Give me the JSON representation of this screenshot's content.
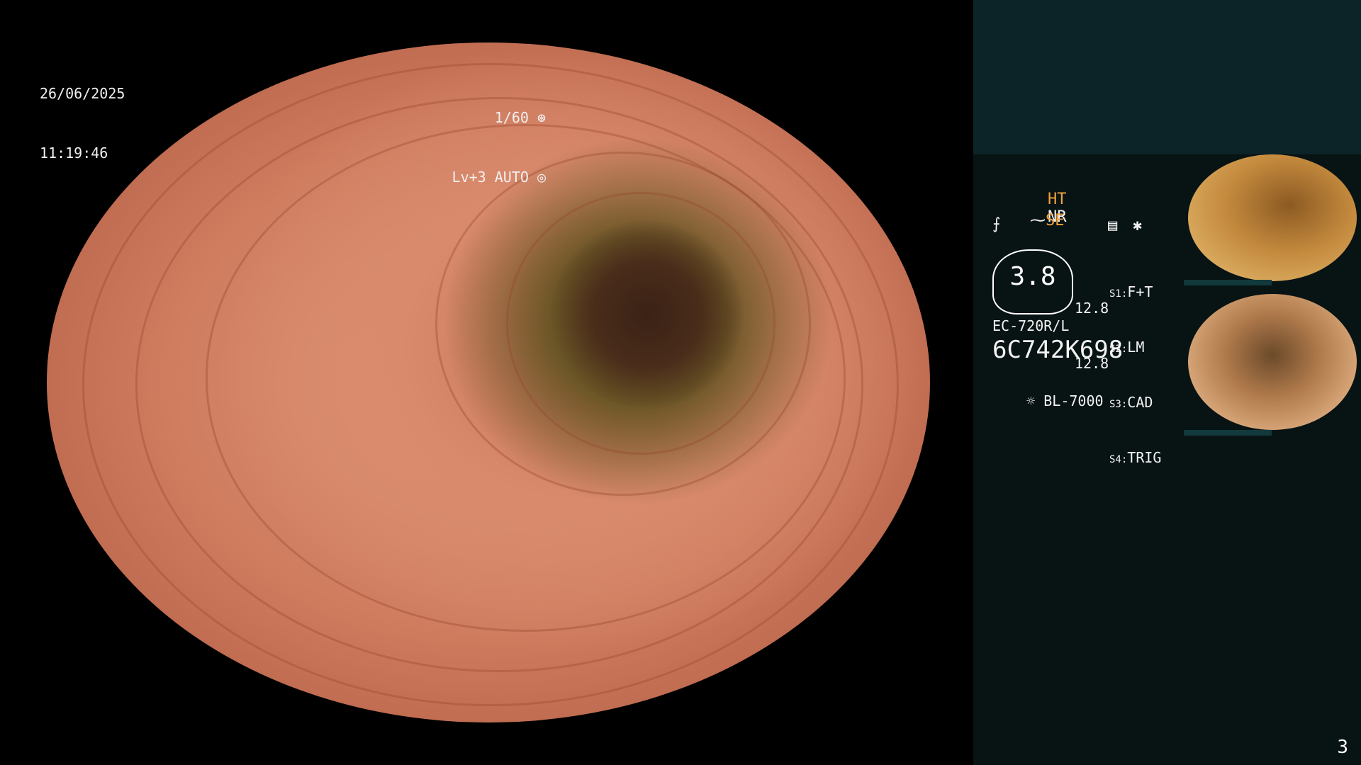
{
  "osd": {
    "date": "26/06/2025",
    "time": "11:19:46",
    "shutter": "1/60",
    "level": "Lv+3 AUTO"
  },
  "panel": {
    "ht_label": "HT",
    "nr_label": "NR",
    "se_label": "SE",
    "gauge_value": "3.8",
    "values": [
      "12.8",
      "12.8"
    ],
    "switches": [
      {
        "key": "S1:",
        "value": "F+T"
      },
      {
        "key": "S2:",
        "value": "LM"
      },
      {
        "key": "S3:",
        "value": "CAD"
      },
      {
        "key": "S4:",
        "value": "TRIG"
      }
    ],
    "scope_model": "EC-720R/L",
    "scope_serial": "6C742K698",
    "light_source": "BL-7000",
    "page_number": "3"
  },
  "icons": {
    "shutter_icon": "aperture-icon",
    "auto_icon": "iris-icon",
    "settings_icon": "menu-icon",
    "freeze_icon": "asterisk-icon",
    "light_icon": "sun-icon"
  },
  "colors": {
    "panel_bg": "#081314",
    "panel_top": "#0c2427",
    "accent": "#f2a13a"
  }
}
